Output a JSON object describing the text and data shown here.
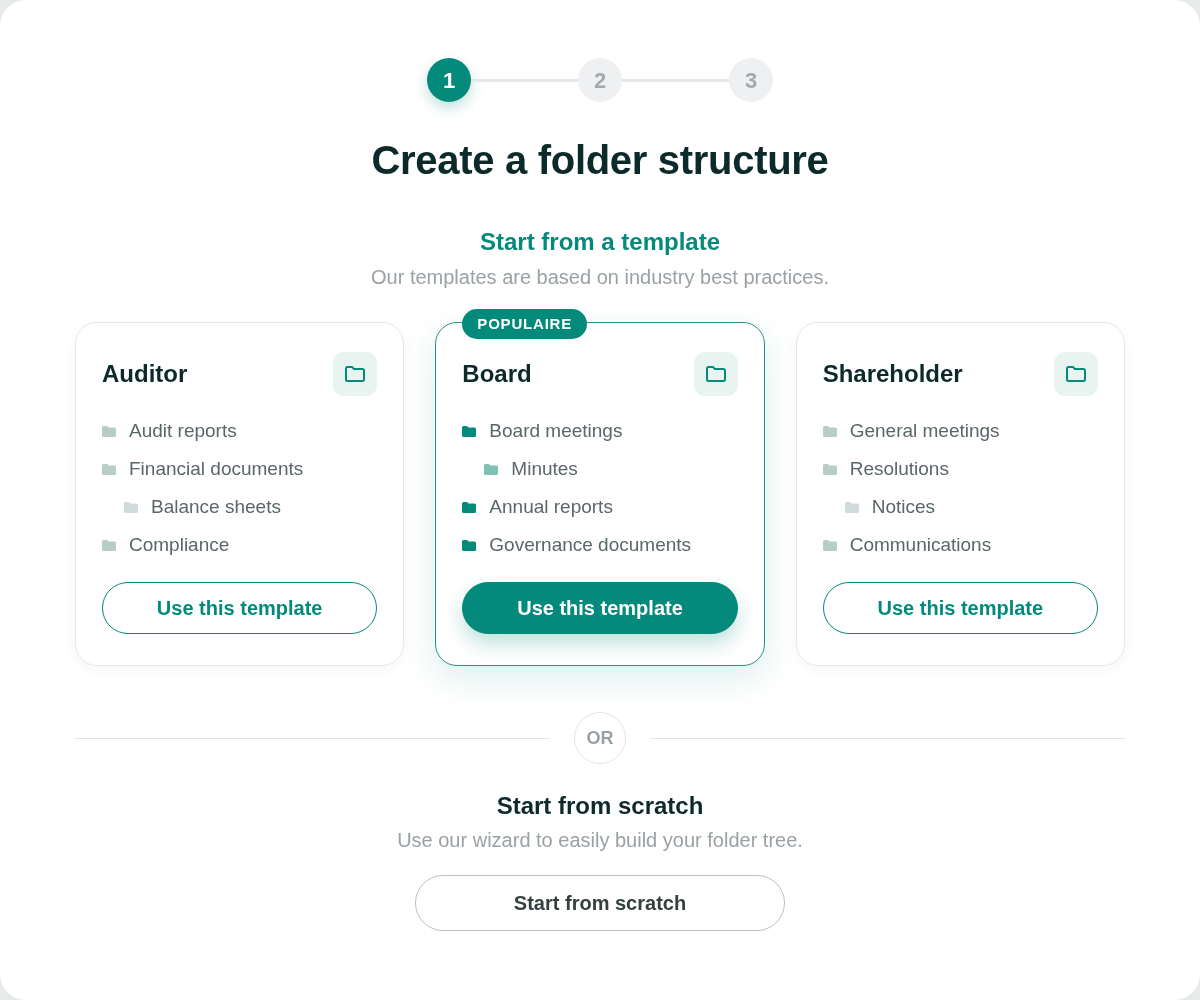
{
  "stepper": {
    "steps": [
      {
        "label": "1",
        "selected": true
      },
      {
        "label": "2",
        "selected": false
      },
      {
        "label": "3",
        "selected": false
      }
    ]
  },
  "title": "Create a folder structure",
  "templates": {
    "heading": "Start from a template",
    "subtitle": "Our templates are based on industry best practices.",
    "cards": [
      {
        "title": "Auditor",
        "featured": false,
        "folders": [
          {
            "name": "Audit reports"
          },
          {
            "name": "Financial documents",
            "children": [
              {
                "name": "Balance sheets"
              }
            ]
          },
          {
            "name": "Compliance"
          }
        ],
        "button": "Use this template"
      },
      {
        "title": "Board",
        "featured": true,
        "badge": "POPULAIRE",
        "folders": [
          {
            "name": "Board meetings",
            "children": [
              {
                "name": "Minutes"
              }
            ]
          },
          {
            "name": "Annual reports"
          },
          {
            "name": "Governance documents"
          }
        ],
        "button": "Use this template"
      },
      {
        "title": "Shareholder",
        "featured": false,
        "folders": [
          {
            "name": "General meetings"
          },
          {
            "name": "Resolutions",
            "children": [
              {
                "name": "Notices"
              }
            ]
          },
          {
            "name": "Communications"
          }
        ],
        "button": "Use this template"
      }
    ]
  },
  "divider": {
    "label": "OR"
  },
  "scratch": {
    "heading": "Start from scratch",
    "subtitle": "Use our wizard to easily build your folder tree.",
    "button": "Start from scratch"
  }
}
